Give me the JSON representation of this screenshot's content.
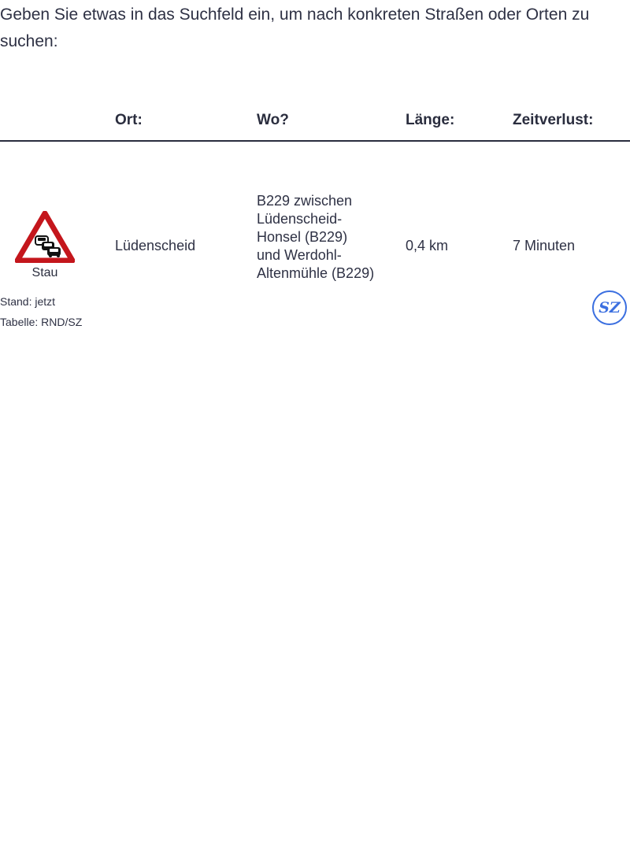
{
  "intro": {
    "text": "Geben Sie etwas in das Suchfeld ein, um nach konkreten Straßen oder Orten zu suchen:"
  },
  "table": {
    "headers": {
      "ort": "Ort:",
      "wo": "Wo?",
      "laenge": "Länge:",
      "zeitverlust": "Zeitverlust:"
    },
    "rows": [
      {
        "type_icon": "traffic-jam-warning-sign-icon",
        "type_label": "Stau",
        "ort": "Lüdenscheid",
        "wo": "B229 zwischen Lüdenscheid-Honsel (B229) und Werdohl-Altenmühle (B229)",
        "laenge": "0,4 km",
        "zeitverlust": "7 Minuten"
      }
    ]
  },
  "footer": {
    "stand": "Stand: jetzt",
    "source": "Tabelle: RND/SZ",
    "logo_text": "SZ",
    "logo_color": "#3b6fe0"
  },
  "colors": {
    "text": "#2a2d3e",
    "sign_red": "#c4161c"
  }
}
